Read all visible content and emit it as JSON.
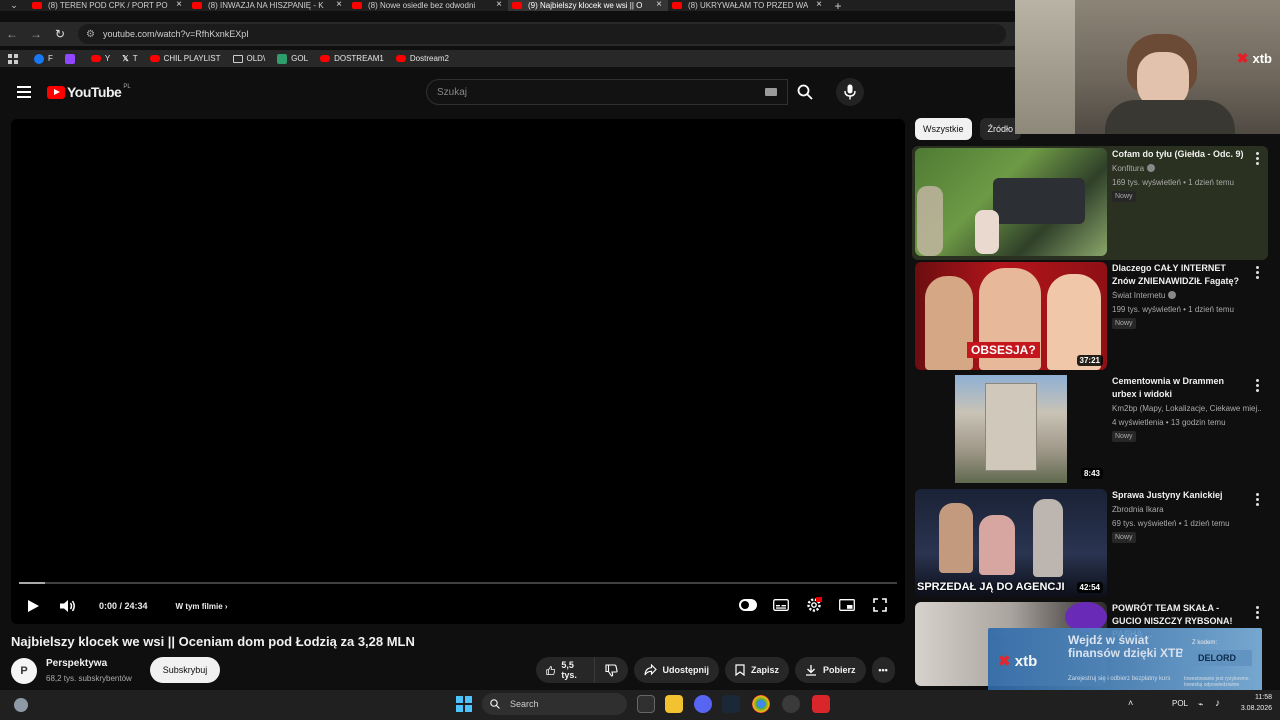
{
  "browser": {
    "tabs": [
      {
        "label": "(8) TEREN POD CPK / PORT PO",
        "active": false
      },
      {
        "label": "(8) INWAZJA NA HISZPANIĘ - K",
        "active": false
      },
      {
        "label": "(8) Nowe osiedle bez odwodni",
        "active": false
      },
      {
        "label": "(9) Najbielszy klocek we wsi || O",
        "active": true
      },
      {
        "label": "(8) UKRYWAŁAM TO PRZED WA",
        "active": false
      }
    ],
    "url": "youtube.com/watch?v=RfhKxnkEXpI",
    "bookmarks": [
      {
        "label": "F",
        "color": "#1877f2"
      },
      {
        "label": "",
        "color": "#9146ff"
      },
      {
        "label": "Y",
        "color": "#ff0000"
      },
      {
        "label": "T",
        "color": "#000000"
      },
      {
        "label": "CHIL PLAYLIST",
        "color": "#ff0000"
      },
      {
        "label": "OLD\\",
        "color": "folder"
      },
      {
        "label": "GOL",
        "color": "#2f9e6e"
      },
      {
        "label": "DOSTREAM1",
        "color": "#ff0000"
      },
      {
        "label": "Dostream2",
        "color": "#ff0000"
      }
    ]
  },
  "youtube": {
    "logo_text": "YouTube",
    "country": "PL",
    "search_placeholder": "Szukaj"
  },
  "player": {
    "time": "0:00 / 24:34",
    "chapters": "W tym filmie",
    "progress_fraction": 0.03
  },
  "video": {
    "title": "Najbielszy klocek we wsi || Oceniam dom pod Łodzią za 3,28 MLN",
    "channel": "Perspektywa",
    "avatar_letter": "P",
    "subscribers": "68,2 tys. subskrybentów",
    "subscribe_label": "Subskrybuj",
    "likes": "5,5 tys.",
    "share_label": "Udostępnij",
    "save_label": "Zapisz",
    "download_label": "Pobierz"
  },
  "chips": [
    "Wszystkie",
    "Źródło"
  ],
  "recommendations": [
    {
      "title": "Cofam do tyłu (Giełda - Odc. 9)",
      "channel": "Konfitura",
      "verified": true,
      "meta": "169 tys. wyświetleń • 1 dzień temu",
      "badge": "Nowy",
      "duration": ""
    },
    {
      "title": "Dlaczego CAŁY INTERNET Znów ZNIENAWIDZIŁ Fagatę?",
      "channel": "Świat Internetu",
      "verified": true,
      "meta": "199 tys. wyświetleń • 1 dzień temu",
      "badge": "Nowy",
      "duration": "37:21",
      "thumb_text": "OBSESJA?"
    },
    {
      "title": "Cementownia w Drammen urbex i widoki",
      "channel": "Km2bp (Mapy, Lokalizacje, Ciekawe miej...",
      "verified": false,
      "meta": "4 wyświetlenia • 13 godzin temu",
      "badge": "Nowy",
      "duration": "8:43"
    },
    {
      "title": "Sprawa Justyny Kanickiej",
      "channel": "Zbrodnia Ikara",
      "verified": false,
      "meta": "69 tys. wyświetleń • 1 dzień temu",
      "badge": "Nowy",
      "duration": "42:54",
      "thumb_text": "SPRZEDAŁ JĄ DO AGENCJI"
    },
    {
      "title": "POWRÓT TEAM SKAŁA - GUCIO NISZCZY RYBSONA! PASHA ...",
      "channel": "",
      "verified": false,
      "meta": "",
      "badge": "",
      "duration": ""
    }
  ],
  "webcam": {
    "brand": "xtb"
  },
  "ad": {
    "brand": "xtb",
    "headline": "Wejdź w świat finansów dzięki XTB",
    "sub": "Zarejestruj się i odbierz bezpłatny kurs",
    "code_label": "Z kodem:",
    "code": "DELORD",
    "fine": "Inwestowanie jest ryzykowne. Inwestuj odpowiedzialnie"
  },
  "taskbar": {
    "search": "Search",
    "lang": "POL",
    "time": "11:58",
    "date": "3.08.2026"
  }
}
